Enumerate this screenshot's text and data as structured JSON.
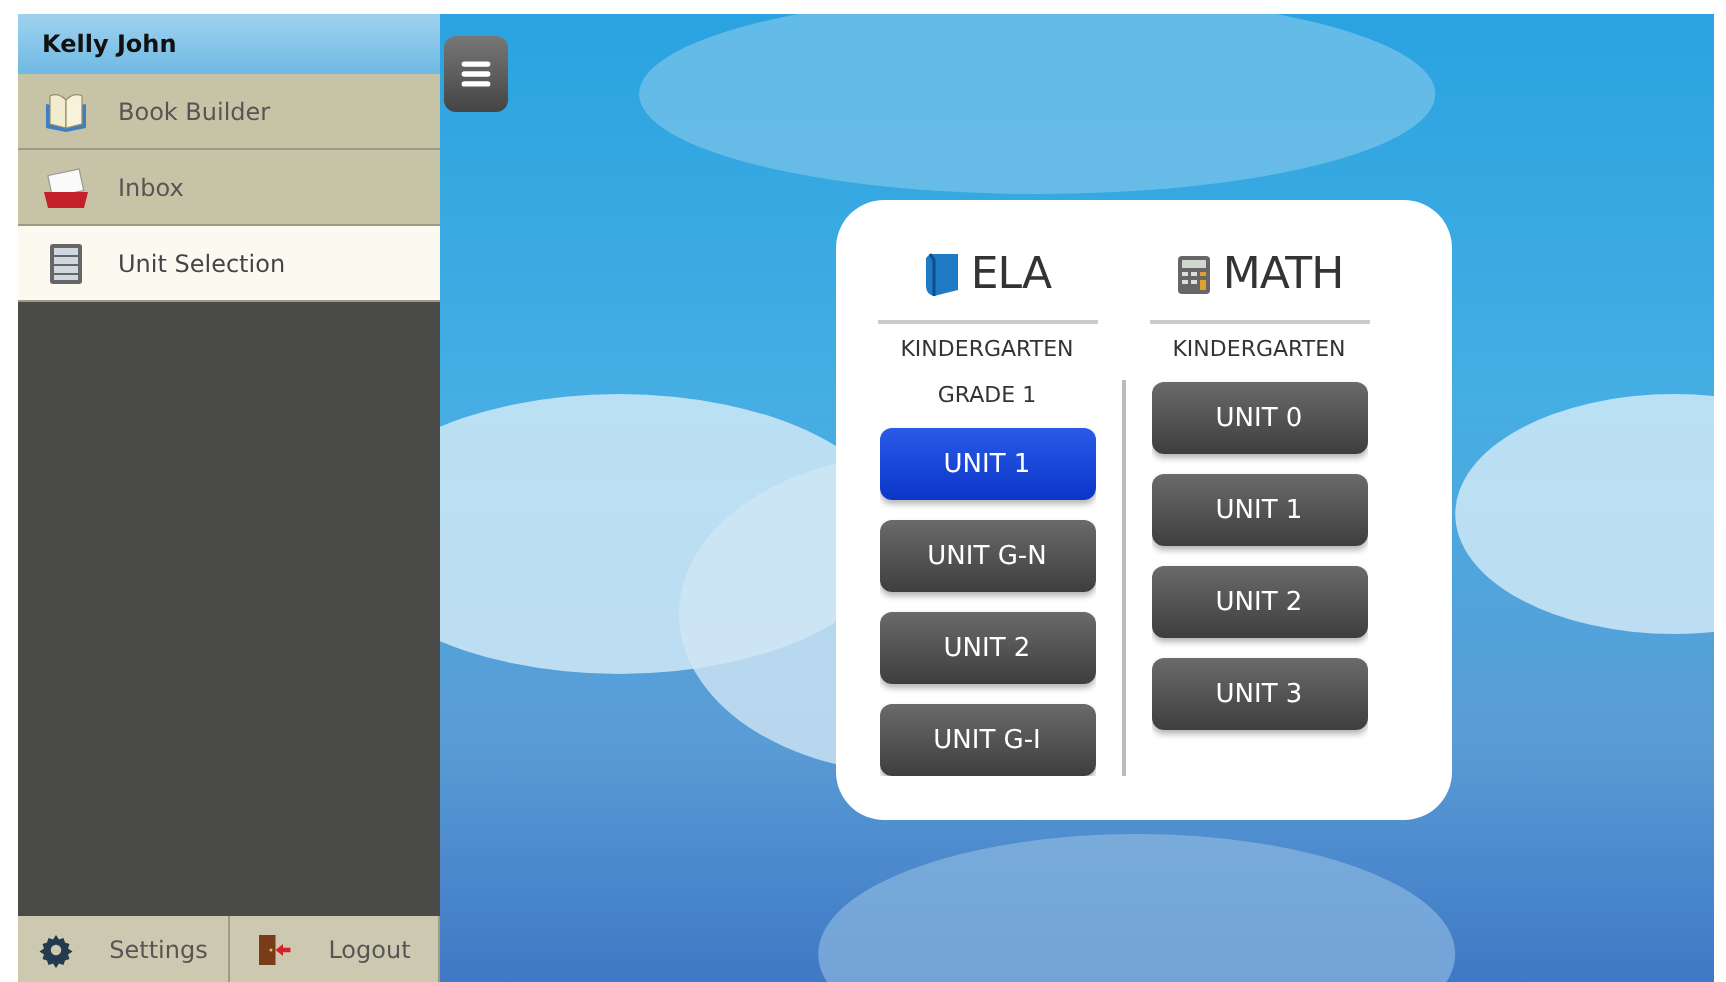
{
  "sidebar": {
    "user": "Kelly John",
    "items": [
      {
        "label": "Book Builder",
        "kind": "book",
        "selected": false
      },
      {
        "label": "Inbox",
        "kind": "inbox",
        "selected": false
      },
      {
        "label": "Unit Selection",
        "kind": "list",
        "selected": true
      }
    ],
    "footer": [
      {
        "label": "Settings",
        "kind": "gear"
      },
      {
        "label": "Logout",
        "kind": "door"
      }
    ]
  },
  "subjects": [
    {
      "title": "ELA",
      "kind": "book",
      "items": [
        {
          "kind": "grade",
          "label": "KINDERGARTEN"
        },
        {
          "kind": "grade",
          "label": "GRADE 1"
        },
        {
          "kind": "unit",
          "label": "UNIT 1",
          "selected": true
        },
        {
          "kind": "unit",
          "label": "UNIT G-N",
          "selected": false
        },
        {
          "kind": "unit",
          "label": "UNIT 2",
          "selected": false
        },
        {
          "kind": "unit",
          "label": "UNIT G-I",
          "selected": false
        }
      ]
    },
    {
      "title": "MATH",
      "kind": "calculator",
      "items": [
        {
          "kind": "grade",
          "label": "KINDERGARTEN"
        },
        {
          "kind": "unit",
          "label": "UNIT 0",
          "selected": false
        },
        {
          "kind": "unit",
          "label": "UNIT 1",
          "selected": false
        },
        {
          "kind": "unit",
          "label": "UNIT 2",
          "selected": false
        },
        {
          "kind": "unit",
          "label": "UNIT 3",
          "selected": false
        }
      ]
    }
  ]
}
